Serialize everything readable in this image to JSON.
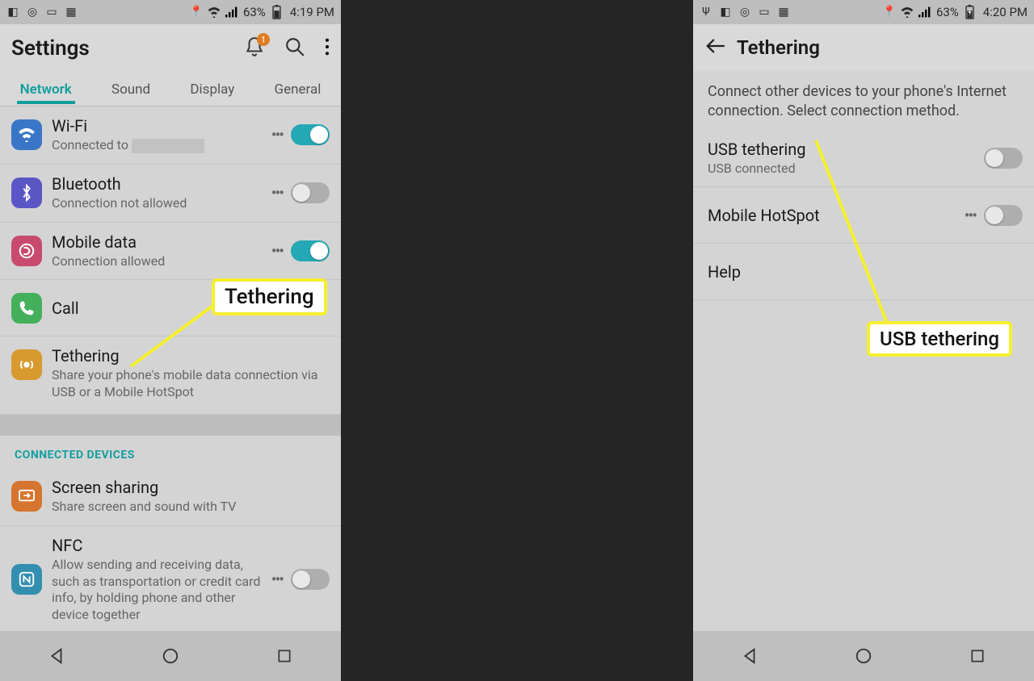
{
  "left": {
    "status": {
      "battery": "63%",
      "time": "4:19 PM"
    },
    "title": "Settings",
    "notif_badge": "1",
    "tabs": [
      "Network",
      "Sound",
      "Display",
      "General"
    ],
    "active_tab": 0,
    "rows": {
      "wifi": {
        "title": "Wi-Fi",
        "sub_prefix": "Connected to ",
        "toggle": true
      },
      "bt": {
        "title": "Bluetooth",
        "sub": "Connection not allowed",
        "toggle": false
      },
      "data": {
        "title": "Mobile data",
        "sub": "Connection allowed",
        "toggle": true
      },
      "call": {
        "title": "Call"
      },
      "tether": {
        "title": "Tethering",
        "sub": "Share your phone's mobile data connection via USB or a Mobile HotSpot"
      },
      "section": "CONNECTED DEVICES",
      "screen": {
        "title": "Screen sharing",
        "sub": "Share screen and sound with TV"
      },
      "nfc": {
        "title": "NFC",
        "sub": "Allow sending and receiving data, such as transportation or credit card info, by holding phone and other device together",
        "toggle": false
      }
    },
    "callout": "Tethering"
  },
  "right": {
    "status": {
      "battery": "63%",
      "time": "4:20 PM"
    },
    "title": "Tethering",
    "desc": "Connect other devices to your phone's Internet connection. Select connection method.",
    "rows": {
      "usb": {
        "title": "USB tethering",
        "sub": "USB connected",
        "toggle": false
      },
      "hotspot": {
        "title": "Mobile HotSpot",
        "toggle": false
      },
      "help": {
        "title": "Help"
      }
    },
    "callout": "USB tethering"
  }
}
